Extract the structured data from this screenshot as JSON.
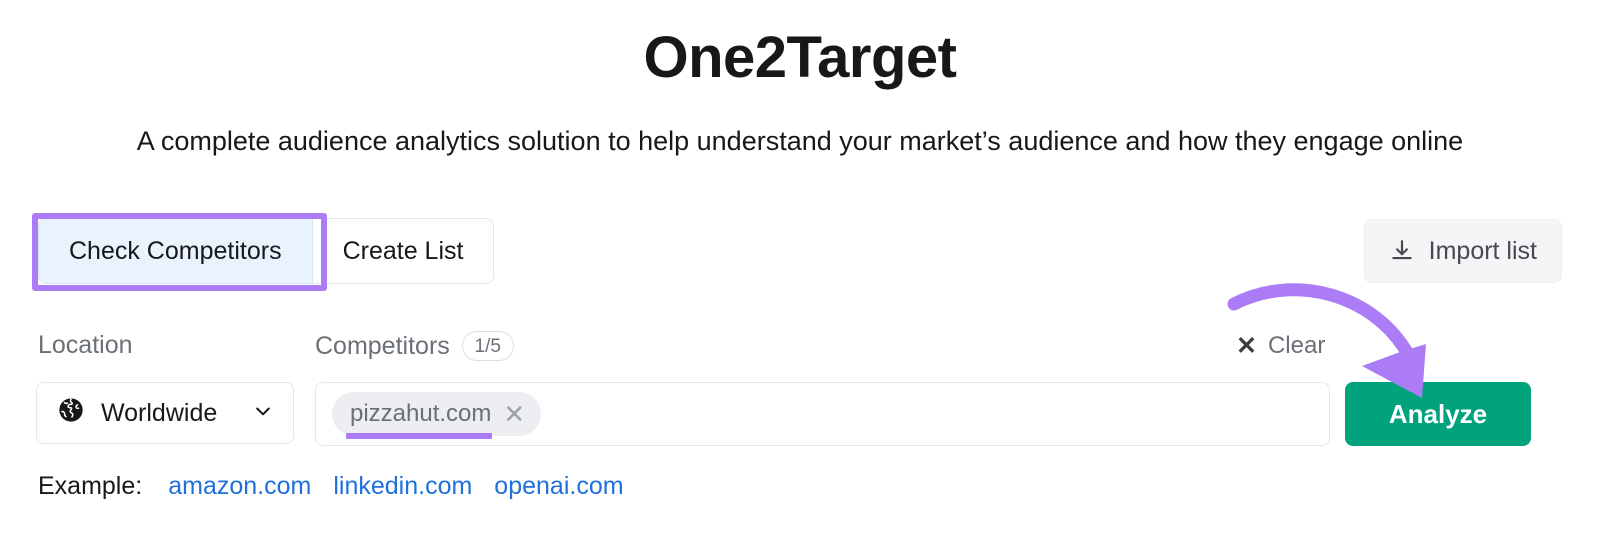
{
  "header": {
    "title": "One2Target",
    "subtitle": "A complete audience analytics solution to help understand your market’s audience and how they engage online"
  },
  "tabs": [
    {
      "label": "Check Competitors",
      "active": true
    },
    {
      "label": "Create List",
      "active": false
    }
  ],
  "toolbar": {
    "import_label": "Import list",
    "import_icon": "download-icon"
  },
  "fields": {
    "location": {
      "label": "Location",
      "value": "Worldwide",
      "icon": "globe-icon",
      "chevron_icon": "chevron-down-icon"
    },
    "competitors": {
      "label": "Competitors",
      "count": "1/5",
      "chips": [
        {
          "label": "pizzahut.com",
          "remove_icon": "close-icon"
        }
      ]
    },
    "clear": {
      "label": "Clear",
      "icon": "close-icon"
    }
  },
  "actions": {
    "analyze_label": "Analyze"
  },
  "examples": {
    "label": "Example:",
    "links": [
      "amazon.com",
      "linkedin.com",
      "openai.com"
    ]
  },
  "annotations": {
    "highlight_color": "#ab7cf5",
    "arrow_color": "#ab7cf5",
    "active_tab_bg": "#e8f3fd",
    "analyze_color": "#00a37c",
    "link_color": "#1f6fdd"
  }
}
